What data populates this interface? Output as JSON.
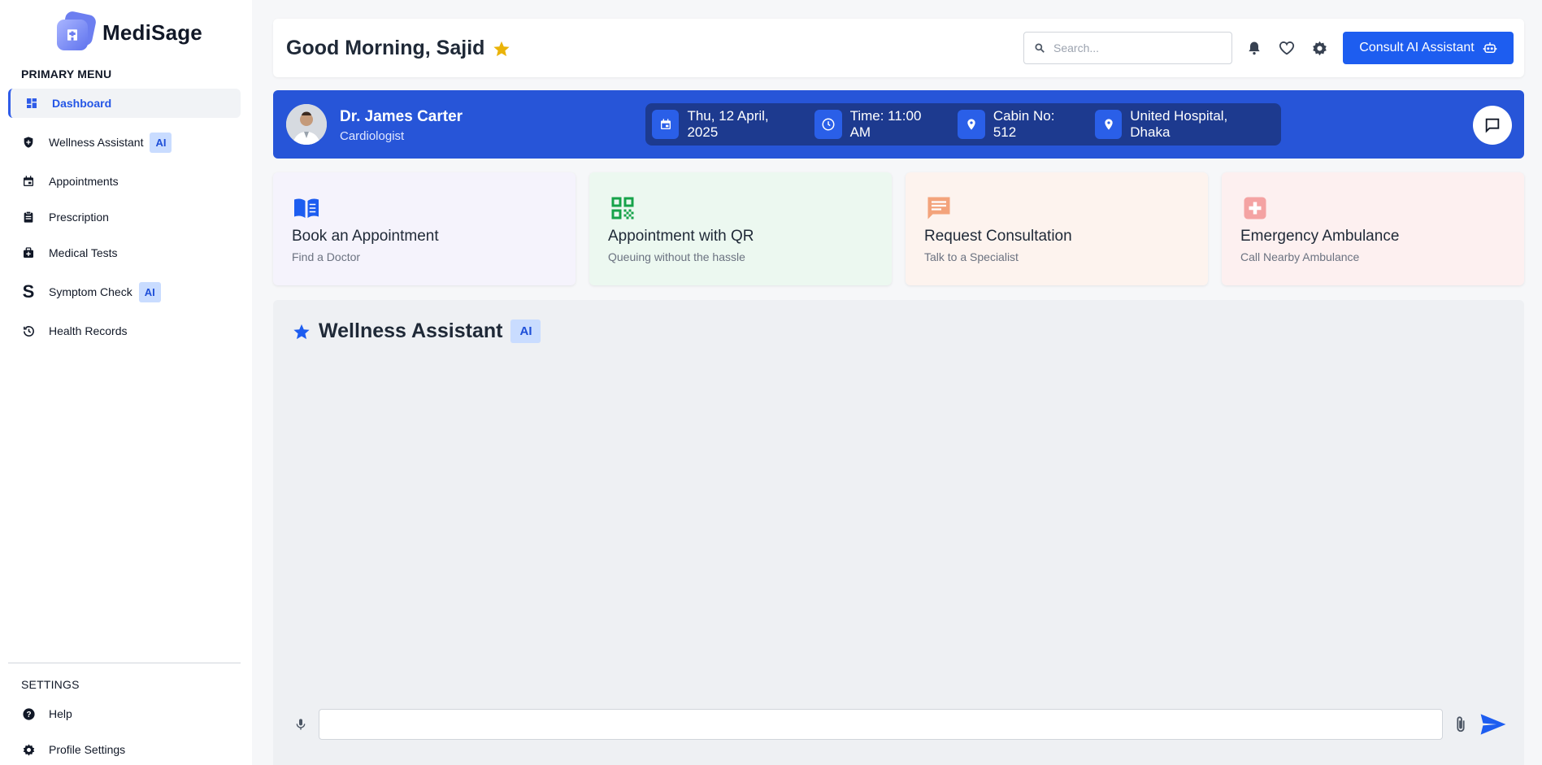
{
  "app": {
    "name": "MediSage"
  },
  "sidebar": {
    "primary_heading": "PRIMARY MENU",
    "items": [
      {
        "label": "Dashboard",
        "icon": "dashboard-icon",
        "active": true
      },
      {
        "label": "Wellness Assistant",
        "icon": "shield-icon",
        "badge": "AI"
      },
      {
        "label": "Appointments",
        "icon": "calendar-icon"
      },
      {
        "label": "Prescription",
        "icon": "clipboard-icon"
      },
      {
        "label": "Medical Tests",
        "icon": "medical-bag-icon"
      },
      {
        "label": "Symptom Check",
        "icon": "s-letter-icon",
        "badge": "AI"
      },
      {
        "label": "Health Records",
        "icon": "history-icon"
      }
    ],
    "settings_heading": "SETTINGS",
    "settings_items": [
      {
        "label": "Help",
        "icon": "help-icon"
      },
      {
        "label": "Profile Settings",
        "icon": "gear-icon"
      }
    ]
  },
  "header": {
    "greeting": "Good Morning, Sajid",
    "search_placeholder": "Search...",
    "consult_label": "Consult AI Assistant"
  },
  "doctor": {
    "name": "Dr. James Carter",
    "specialty": "Cardiologist",
    "date": "Thu, 12 April, 2025",
    "time": "Time: 11:00 AM",
    "cabin": "Cabin No: 512",
    "hospital": "United Hospital, Dhaka"
  },
  "cards": [
    {
      "title": "Book an Appointment",
      "subtitle": "Find a Doctor",
      "bg": "#f5f3fc",
      "icon_color": "#1d5df0"
    },
    {
      "title": "Appointment with QR",
      "subtitle": "Queuing without the hassle",
      "bg": "#ecf8f0",
      "icon_color": "#16a34a"
    },
    {
      "title": "Request Consultation",
      "subtitle": "Talk to a Specialist",
      "bg": "#fdf3ee",
      "icon_color": "#f3a37b"
    },
    {
      "title": "Emergency Ambulance",
      "subtitle": "Call Nearby Ambulance",
      "bg": "#fdf0f0",
      "icon_color": "#f4a3a3"
    }
  ],
  "wellness": {
    "title": "Wellness Assistant",
    "badge": "AI",
    "message_placeholder": ""
  },
  "colors": {
    "accent": "#1d5df0",
    "banner": "#2755d8",
    "star": "#eab308"
  }
}
